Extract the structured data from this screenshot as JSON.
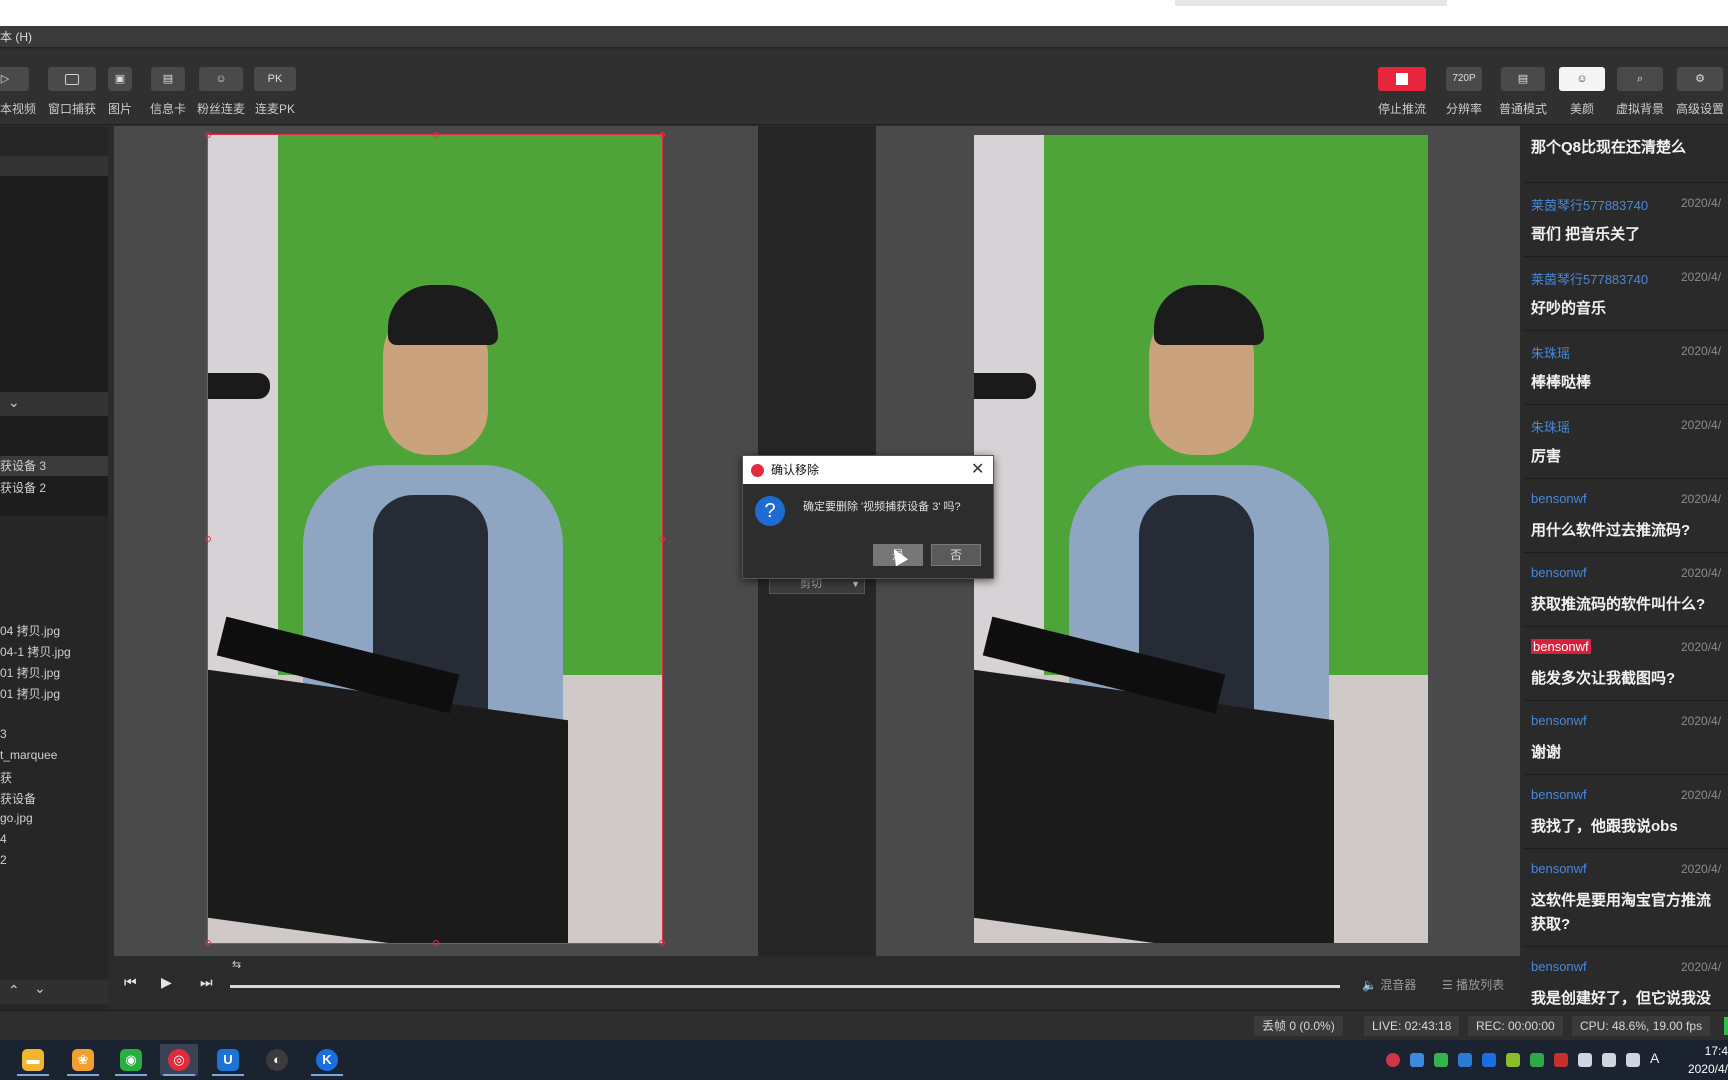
{
  "menu": {
    "help": "本 (H)"
  },
  "toolbar": {
    "left": [
      {
        "icon": "play-icon",
        "label": "本视频"
      },
      {
        "icon": "window-capture-icon",
        "label": "窗口捕获"
      },
      {
        "icon": "image-icon",
        "label": "图片"
      },
      {
        "icon": "card-icon",
        "label": "信息卡"
      },
      {
        "icon": "fans-icon",
        "label": "粉丝连麦"
      },
      {
        "icon": "pk-icon",
        "label": "连麦PK",
        "text": "PK"
      }
    ],
    "right": [
      {
        "icon": "stop-icon",
        "label": "停止推流"
      },
      {
        "icon": "resolution-icon",
        "label": "分辨率",
        "text": "720P"
      },
      {
        "icon": "layout-icon",
        "label": "普通模式"
      },
      {
        "icon": "face-icon",
        "label": "美颜"
      },
      {
        "icon": "background-icon",
        "label": "虚拟背景"
      },
      {
        "icon": "gear-icon",
        "label": "高级设置"
      }
    ]
  },
  "sources": {
    "scene_items": [
      "获设备 3",
      "获设备 2"
    ],
    "files": [
      "04 拷贝.jpg",
      "04-1 拷贝.jpg",
      "01 拷贝.jpg",
      "01 拷贝.jpg",
      "3",
      "t_marquee",
      "获",
      "获设备",
      "go.jpg",
      "4",
      "2"
    ]
  },
  "dialog": {
    "title": "确认移除",
    "message": "确定要删除 '视频捕获设备 3' 吗?",
    "yes": "是",
    "no": "否"
  },
  "transition": {
    "value": "剪切"
  },
  "playbar": {
    "mixer": "混音器",
    "playlist": "播放列表"
  },
  "chat": {
    "first_text": "那个Q8比现在还清楚么",
    "messages": [
      {
        "user": "莱茵琴行577883740",
        "date": "2020/4/",
        "text": "哥们 把音乐关了"
      },
      {
        "user": "莱茵琴行577883740",
        "date": "2020/4/",
        "text": "好吵的音乐"
      },
      {
        "user": "朱珠瑶",
        "date": "2020/4/",
        "text": "棒棒哒棒"
      },
      {
        "user": "朱珠瑶",
        "date": "2020/4/",
        "text": "厉害"
      },
      {
        "user": "bensonwf",
        "date": "2020/4/",
        "text": "用什么软件过去推流码?"
      },
      {
        "user": "bensonwf",
        "date": "2020/4/",
        "text": "获取推流码的软件叫什么?"
      },
      {
        "user": "bensonwf",
        "date": "2020/4/",
        "text": "能发多次让我截图吗?",
        "highlight": true
      },
      {
        "user": "bensonwf",
        "date": "2020/4/",
        "text": "谢谢"
      },
      {
        "user": "bensonwf",
        "date": "2020/4/",
        "text": "我找了，他跟我说obs"
      },
      {
        "user": "bensonwf",
        "date": "2020/4/",
        "text": "这软件是要用淘宝官方推流",
        "text2": "获取?"
      },
      {
        "user": "bensonwf",
        "date": "2020/4/",
        "text": "我是创建好了，但它说我没"
      }
    ]
  },
  "status": {
    "dropped": "丢帧 0 (0.0%)",
    "live": "LIVE: 02:43:18",
    "rec": "REC: 00:00:00",
    "cpu": "CPU: 48.6%, 19.00 fps"
  },
  "clock": {
    "time": "17:4",
    "date": "2020/4/"
  },
  "taskbar": [
    "explorer-icon",
    "photos-icon",
    "wechat-icon",
    "obs-app-icon",
    "u-app-icon",
    "obs-icon",
    "k-app-icon"
  ],
  "colors": {
    "accent": "#e7263c",
    "username": "#4a88d6",
    "highlight": "#d9203a"
  }
}
